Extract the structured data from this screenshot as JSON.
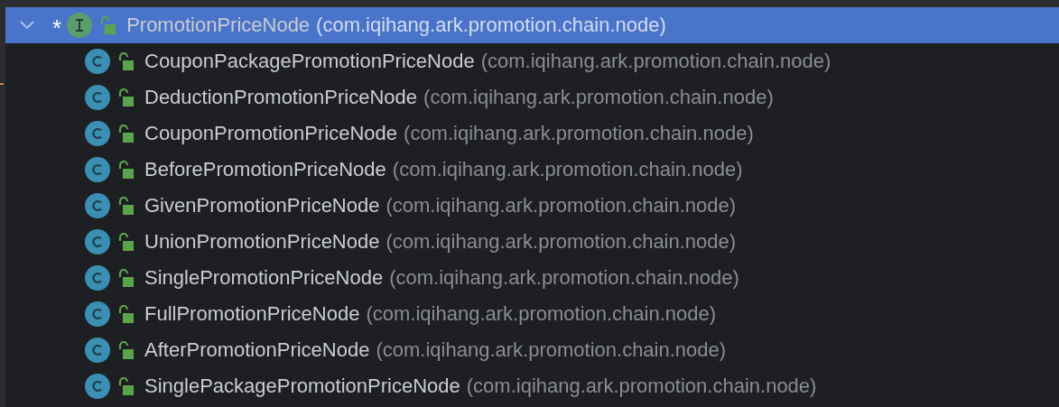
{
  "tree": {
    "kind": "interface",
    "mark": "*",
    "name": "PromotionPriceNode",
    "package": "(com.iqihang.ark.promotion.chain.node)",
    "expanded": true,
    "selected": true,
    "children": [
      {
        "kind": "class",
        "name": "CouponPackagePromotionPriceNode",
        "package": "(com.iqihang.ark.promotion.chain.node)",
        "selected": false
      },
      {
        "kind": "class",
        "name": "DeductionPromotionPriceNode",
        "package": "(com.iqihang.ark.promotion.chain.node)",
        "selected": false
      },
      {
        "kind": "class",
        "name": "CouponPromotionPriceNode",
        "package": "(com.iqihang.ark.promotion.chain.node)",
        "selected": false
      },
      {
        "kind": "class",
        "name": "BeforePromotionPriceNode",
        "package": "(com.iqihang.ark.promotion.chain.node)",
        "selected": false
      },
      {
        "kind": "class",
        "name": "GivenPromotionPriceNode",
        "package": "(com.iqihang.ark.promotion.chain.node)",
        "selected": false
      },
      {
        "kind": "class",
        "name": "UnionPromotionPriceNode",
        "package": "(com.iqihang.ark.promotion.chain.node)",
        "selected": false
      },
      {
        "kind": "class",
        "name": "SinglePromotionPriceNode",
        "package": "(com.iqihang.ark.promotion.chain.node)",
        "selected": false
      },
      {
        "kind": "class",
        "name": "FullPromotionPriceNode",
        "package": "(com.iqihang.ark.promotion.chain.node)",
        "selected": false
      },
      {
        "kind": "class",
        "name": "AfterPromotionPriceNode",
        "package": "(com.iqihang.ark.promotion.chain.node)",
        "selected": false
      },
      {
        "kind": "class",
        "name": "SinglePackagePromotionPriceNode",
        "package": "(com.iqihang.ark.promotion.chain.node)",
        "selected": false
      }
    ]
  }
}
